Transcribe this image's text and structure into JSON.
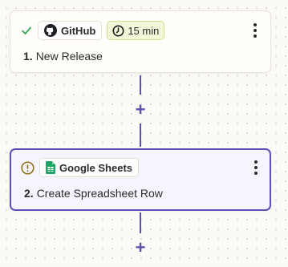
{
  "steps": [
    {
      "status_icon": "check-icon",
      "app_name": "GitHub",
      "app_icon": "github-icon",
      "time_label": "15 min",
      "time_icon": "clock-icon",
      "number": "1.",
      "title": "New Release"
    },
    {
      "status_icon": "warning-circle-icon",
      "app_name": "Google Sheets",
      "app_icon": "google-sheets-icon",
      "number": "2.",
      "title": "Create Spreadsheet Row"
    }
  ],
  "colors": {
    "accent": "#5f4fb0",
    "success": "#3aa55a",
    "warning": "#9a7a12",
    "sheets_green": "#1fa463"
  }
}
